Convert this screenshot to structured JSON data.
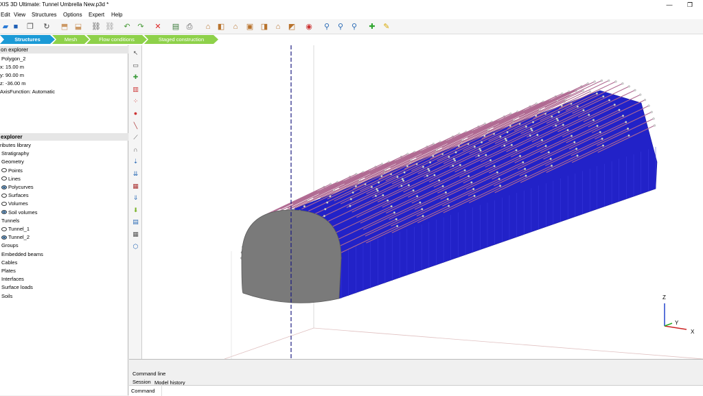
{
  "window": {
    "title": "XIS 3D Ultimate: Tunnel Umbrella New.p3d *",
    "minimize": "—",
    "restore": "❐"
  },
  "menu": [
    "Edit",
    "View",
    "Structures",
    "Options",
    "Expert",
    "Help"
  ],
  "toolbar_icons": [
    "open-icon",
    "save-icon",
    "copy-icon",
    "refresh-icon",
    "import-icon",
    "export-icon",
    "link-icon",
    "unlink-icon",
    "undo-icon",
    "redo-icon",
    "delete-icon",
    "report-icon",
    "print-icon",
    "home-icon",
    "front-view-icon",
    "top-view-icon",
    "box-view-icon",
    "side-view-icon",
    "iso-view-icon",
    "perspective-icon",
    "camera-icon",
    "zoom-in-icon",
    "zoom-out-icon",
    "zoom-window-icon",
    "pan-icon",
    "highlight-icon"
  ],
  "tabs": [
    {
      "label": "Structures",
      "active": true
    },
    {
      "label": "Mesh",
      "active": false
    },
    {
      "label": "Flow conditions",
      "active": false
    },
    {
      "label": "Staged construction",
      "active": false
    }
  ],
  "selection_explorer": {
    "header": "on explorer",
    "name": "Polygon_2",
    "x": "x: 15.00 m",
    "y": "y: 90.00 m",
    "z": "z: -36.00 m",
    "axis_function": "AxisFunction: Automatic"
  },
  "model_explorer": {
    "header": "explorer",
    "items": [
      {
        "label": "ributes library",
        "indent": 0,
        "eye": "none"
      },
      {
        "label": "Stratigraphy",
        "indent": 1,
        "eye": "none"
      },
      {
        "label": "Geometry",
        "indent": 1,
        "eye": "none"
      },
      {
        "label": "Points",
        "indent": 1,
        "eye": "off"
      },
      {
        "label": "Lines",
        "indent": 1,
        "eye": "off"
      },
      {
        "label": "Polycurves",
        "indent": 1,
        "eye": "blue"
      },
      {
        "label": "Surfaces",
        "indent": 1,
        "eye": "off"
      },
      {
        "label": "Volumes",
        "indent": 1,
        "eye": "off"
      },
      {
        "label": "Soil volumes",
        "indent": 1,
        "eye": "blue"
      },
      {
        "label": "Tunnels",
        "indent": 1,
        "eye": "none"
      },
      {
        "label": "Tunnel_1",
        "indent": 1,
        "eye": "off"
      },
      {
        "label": "Tunnel_2",
        "indent": 1,
        "eye": "blue"
      },
      {
        "label": "Groups",
        "indent": 1,
        "eye": "none"
      },
      {
        "label": "Embedded beams",
        "indent": 1,
        "eye": "none"
      },
      {
        "label": "Cables",
        "indent": 1,
        "eye": "none"
      },
      {
        "label": "Plates",
        "indent": 1,
        "eye": "none"
      },
      {
        "label": "Interfaces",
        "indent": 1,
        "eye": "none"
      },
      {
        "label": "Surface loads",
        "indent": 1,
        "eye": "none"
      },
      {
        "label": "Soils",
        "indent": 1,
        "eye": "none"
      }
    ]
  },
  "side_tools": [
    "select-icon",
    "move-icon",
    "add-point-icon",
    "create-surface-icon",
    "array-icon",
    "point-load-icon",
    "line-icon",
    "beam-icon",
    "tunnel-icon",
    "line-load-icon",
    "surface-load-icon",
    "volume-icon",
    "prescribed-displacement-icon",
    "flow-icon",
    "import-soil-icon",
    "table-icon",
    "settings-icon"
  ],
  "axes": {
    "z": "Z",
    "y": "Y",
    "x": "X"
  },
  "colors": {
    "lining": "#2222c8",
    "face": "#7a7a7a",
    "umbrella": "#b06a92",
    "accent_tab": "#1b9ad6",
    "green_tab": "#8ed14a"
  },
  "command": {
    "title": "Command line",
    "session": "Session",
    "model_history": "Model history",
    "prompt": "Command"
  }
}
